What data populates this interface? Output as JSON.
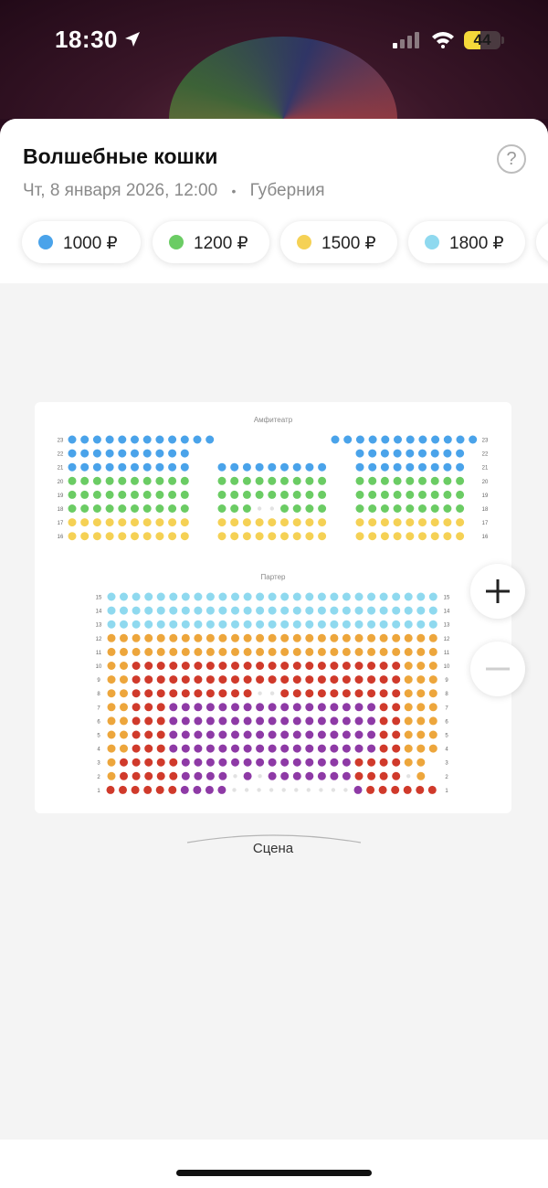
{
  "status": {
    "time": "18:30",
    "battery_level": "44",
    "battery_percent": 44
  },
  "event": {
    "title": "Волшебные кошки",
    "date": "Чт, 8 января 2026, 12:00",
    "separator": "•",
    "venue": "Губерния",
    "help": "?"
  },
  "prices": [
    {
      "label": "1000 ₽",
      "color": "#4aa3ea"
    },
    {
      "label": "1200 ₽",
      "color": "#6bcc64"
    },
    {
      "label": "1500 ₽",
      "color": "#f5d155"
    },
    {
      "label": "1800 ₽",
      "color": "#8fd9ef"
    },
    {
      "label": "",
      "color": "#ffffff"
    }
  ],
  "hall": {
    "amphitheater_label": "Амфитеатр",
    "parterre_label": "Партер",
    "stage_label": "Сцена",
    "amph_rows": [
      "23",
      "22",
      "21",
      "20",
      "19",
      "18",
      "17",
      "16"
    ],
    "parterre_rows": [
      "15",
      "14",
      "13",
      "12",
      "11",
      "10",
      "9",
      "8",
      "7",
      "6",
      "5",
      "4",
      "3",
      "2",
      "1"
    ]
  },
  "seat_colors": {
    "blue": "#4aa3ea",
    "green": "#6bcc64",
    "yellow": "#f5d155",
    "lightblue": "#8fd9ef",
    "orange": "#eda63c",
    "red": "#d03a2b",
    "purple": "#8e3aa6",
    "taken": "#e2e2e2"
  },
  "zoom": {
    "in": "+",
    "out": "−"
  }
}
